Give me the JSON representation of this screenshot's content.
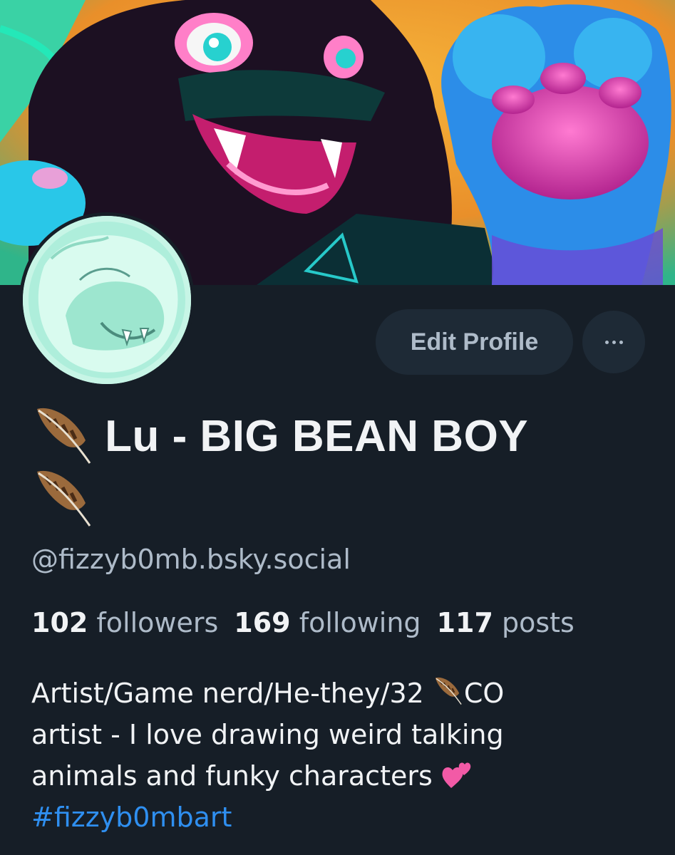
{
  "profile": {
    "display_name": "Lu - BIG BEAN BOY",
    "handle": "@fizzyb0mb.bsky.social",
    "name_icon": "feather-icon",
    "avatar_icon": "avatar-image",
    "banner_icon": "banner-image"
  },
  "actions": {
    "edit_label": "Edit Profile",
    "more_icon": "ellipsis-icon"
  },
  "stats": {
    "followers_count": "102",
    "followers_label": "followers",
    "following_count": "169",
    "following_label": "following",
    "posts_count": "117",
    "posts_label": "posts"
  },
  "bio": {
    "line1_a": "Artist/Game nerd/He-they/32 ",
    "line1_b": "CO",
    "line2": "artist - I love drawing weird talking",
    "line3": "animals and funky characters ",
    "hashtag": "#fizzyb0mbart",
    "feather_icon": "feather-icon",
    "hearts_icon": "two-hearts-icon"
  },
  "colors": {
    "background": "#161e27",
    "button_bg": "#1e2a36",
    "muted_text": "#aebbc9",
    "link": "#2f8ff0"
  }
}
